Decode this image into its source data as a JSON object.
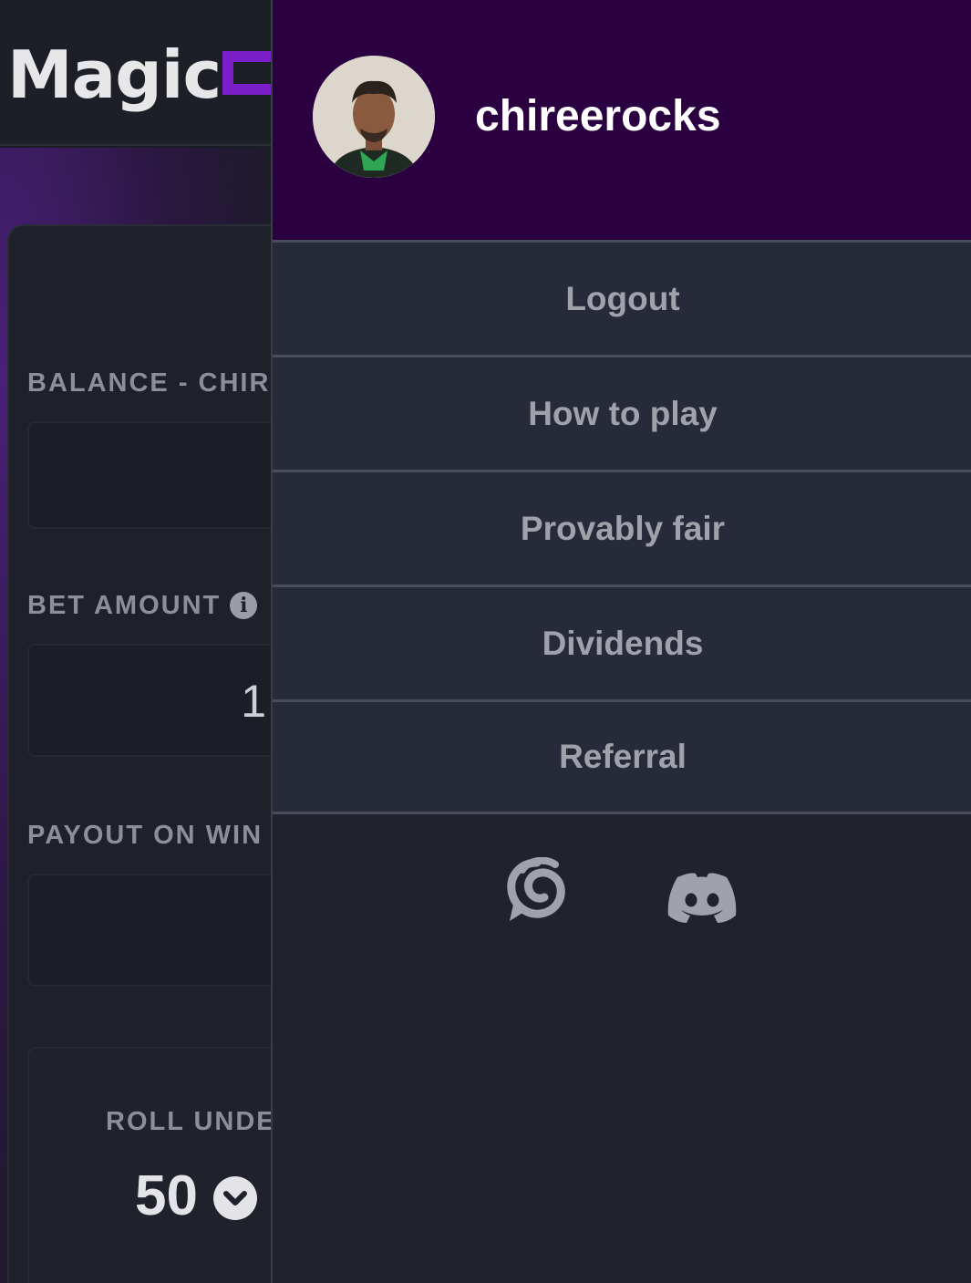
{
  "background": {
    "logo_text": "Magic",
    "balance_label": "BALANCE - CHIRE",
    "bet_amount_label": "BET AMOUNT",
    "bet_amount_value": "1",
    "payout_label": "PAYOUT ON WIN",
    "roll_label": "ROLL UNDEI",
    "roll_value": "50"
  },
  "drawer": {
    "username": "chireerocks",
    "menu": [
      {
        "label": "Logout"
      },
      {
        "label": "How to play"
      },
      {
        "label": "Provably fair"
      },
      {
        "label": "Dividends"
      },
      {
        "label": "Referral"
      }
    ],
    "social_icons": [
      "steemit-icon",
      "discord-icon"
    ]
  },
  "colors": {
    "drawer_header": "#2a0041",
    "menu_bg": "#272b39",
    "menu_text": "#9fa1ab",
    "accent_purple": "#7a1ec9"
  }
}
